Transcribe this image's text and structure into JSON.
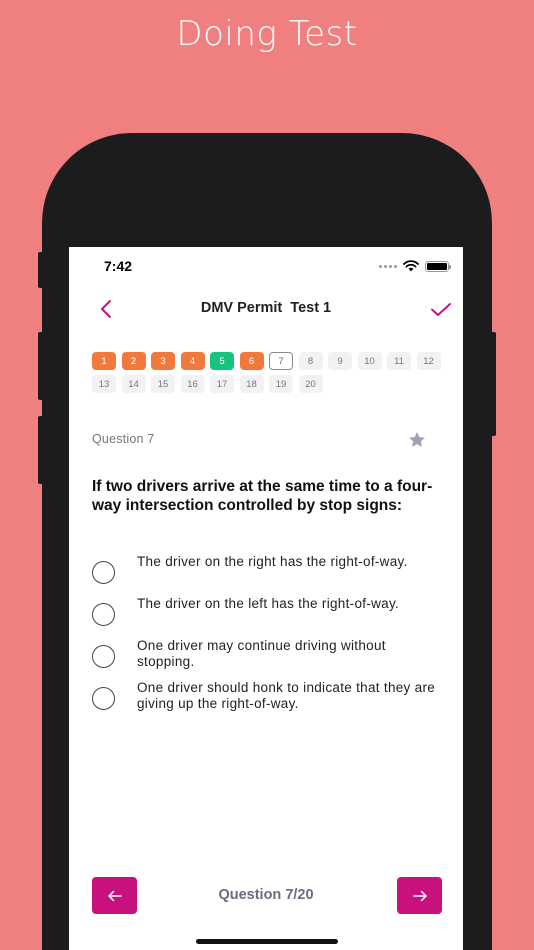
{
  "promo": {
    "title": "Doing Test"
  },
  "status_bar": {
    "time": "7:42"
  },
  "header": {
    "title": "DMV Permit  Test 1"
  },
  "question_grid": {
    "rows": [
      [
        {
          "num": "1",
          "state": "wrong"
        },
        {
          "num": "2",
          "state": "wrong"
        },
        {
          "num": "3",
          "state": "wrong"
        },
        {
          "num": "4",
          "state": "wrong"
        },
        {
          "num": "5",
          "state": "correct"
        },
        {
          "num": "6",
          "state": "wrong"
        },
        {
          "num": "7",
          "state": "current"
        },
        {
          "num": "8",
          "state": "unanswered"
        },
        {
          "num": "9",
          "state": "unanswered"
        },
        {
          "num": "10",
          "state": "unanswered"
        },
        {
          "num": "11",
          "state": "unanswered"
        },
        {
          "num": "12",
          "state": "unanswered"
        }
      ],
      [
        {
          "num": "13",
          "state": "unanswered"
        },
        {
          "num": "14",
          "state": "unanswered"
        },
        {
          "num": "15",
          "state": "unanswered"
        },
        {
          "num": "16",
          "state": "unanswered"
        },
        {
          "num": "17",
          "state": "unanswered"
        },
        {
          "num": "18",
          "state": "unanswered"
        },
        {
          "num": "19",
          "state": "unanswered"
        },
        {
          "num": "20",
          "state": "unanswered"
        }
      ]
    ],
    "colors": {
      "wrong": "#f07a3c",
      "correct": "#19c37d"
    }
  },
  "question": {
    "label": "Question 7",
    "text": "If two drivers arrive at the same time to a four-way intersection controlled by stop signs:",
    "answers": [
      "The driver on the right has the right-of-way.",
      "The driver on the left has the right-of-way.",
      "One driver may continue driving without stopping.",
      "One driver should honk to indicate that they are giving up the right-of-way."
    ]
  },
  "footer": {
    "progress": "Question 7/20"
  },
  "colors": {
    "accent": "#c8107e",
    "background": "#f08080"
  },
  "icons": {
    "back": "chevron-left-icon",
    "submit": "checkmark-icon",
    "favorite": "star-icon",
    "prev": "arrow-left-icon",
    "next": "arrow-right-icon"
  }
}
